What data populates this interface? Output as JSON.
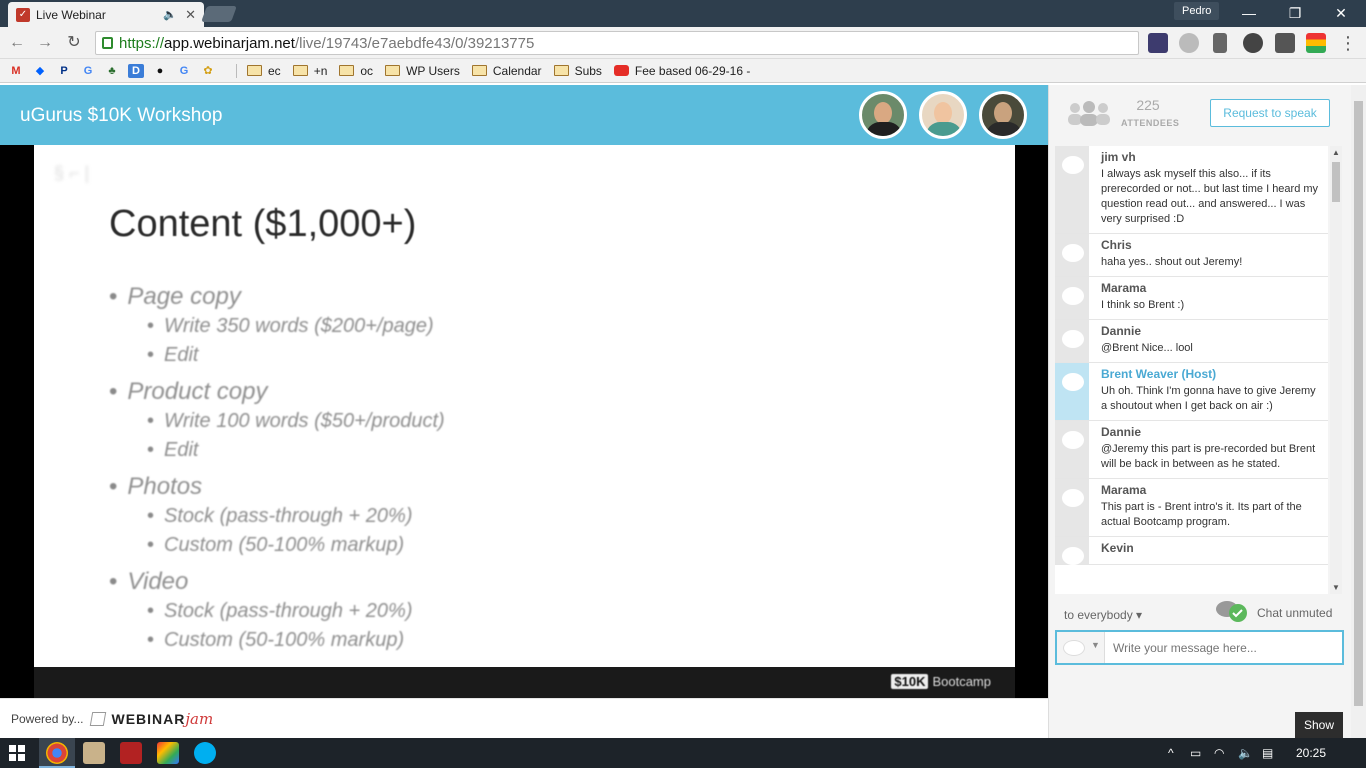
{
  "browser": {
    "tab_title": "Live Webinar",
    "profile_name": "Pedro",
    "url_scheme": "https://",
    "url_host": "app.webinarjam.net",
    "url_path": "/live/19743/e7aebdfe43/0/39213775",
    "bookmarks": [
      "ec",
      "+n",
      "oc",
      "WP Users",
      "Calendar",
      "Subs"
    ],
    "bookmark_video": "Fee based 06-29-16 -"
  },
  "webinar": {
    "title": "uGurus $10K Workshop",
    "hosts": [
      "host-1",
      "host-2",
      "host-3"
    ]
  },
  "slide": {
    "title": "Content ($1,000+)",
    "bullets": [
      {
        "label": "Page copy",
        "subs": [
          "Write 350 words ($200+/page)",
          "Edit"
        ]
      },
      {
        "label": "Product copy",
        "subs": [
          "Write 100 words ($50+/product)",
          "Edit"
        ]
      },
      {
        "label": "Photos",
        "subs": [
          "Stock (pass-through + 20%)",
          "Custom (50-100% markup)"
        ]
      },
      {
        "label": "Video",
        "subs": [
          "Stock (pass-through + 20%)",
          "Custom (50-100% markup)"
        ]
      }
    ],
    "brand_box": "$10K",
    "brand_text": "Bootcamp"
  },
  "powered": {
    "label": "Powered by...",
    "logo_a": "WEBINAR",
    "logo_b": "jam"
  },
  "attendees": {
    "count": "225",
    "label": "ATTENDEES",
    "request_button": "Request to speak"
  },
  "chat": {
    "messages": [
      {
        "name": "jim vh",
        "text": "I always ask myself this also... if its prerecorded or not... but last time I heard my question read out... and answered... I was very surprised :D",
        "host": false
      },
      {
        "name": "Chris",
        "text": "haha yes.. shout out Jeremy!",
        "host": false
      },
      {
        "name": "Marama",
        "text": "I think so Brent :)",
        "host": false
      },
      {
        "name": "Dannie",
        "text": "@Brent Nice... lool",
        "host": false
      },
      {
        "name": "Brent Weaver (Host)",
        "text": "Uh oh. Think I'm gonna have to give Jeremy a shoutout when I get back on air :)",
        "host": true
      },
      {
        "name": "Dannie",
        "text": "@Jeremy this part is pre-recorded but Brent will be back in between as he stated.",
        "host": false
      },
      {
        "name": "Marama",
        "text": "This part is - Brent intro's it. Its part of the actual Bootcamp program.",
        "host": false
      },
      {
        "name": "Kevin",
        "text": "",
        "host": false
      }
    ],
    "recipient": "to everybody",
    "status": "Chat unmuted",
    "input_placeholder": "Write your message here...",
    "show_button": "Show"
  },
  "taskbar": {
    "clock": "20:25"
  },
  "colors": {
    "accent": "#5bbcdc",
    "host_name": "#4aa9d3"
  }
}
